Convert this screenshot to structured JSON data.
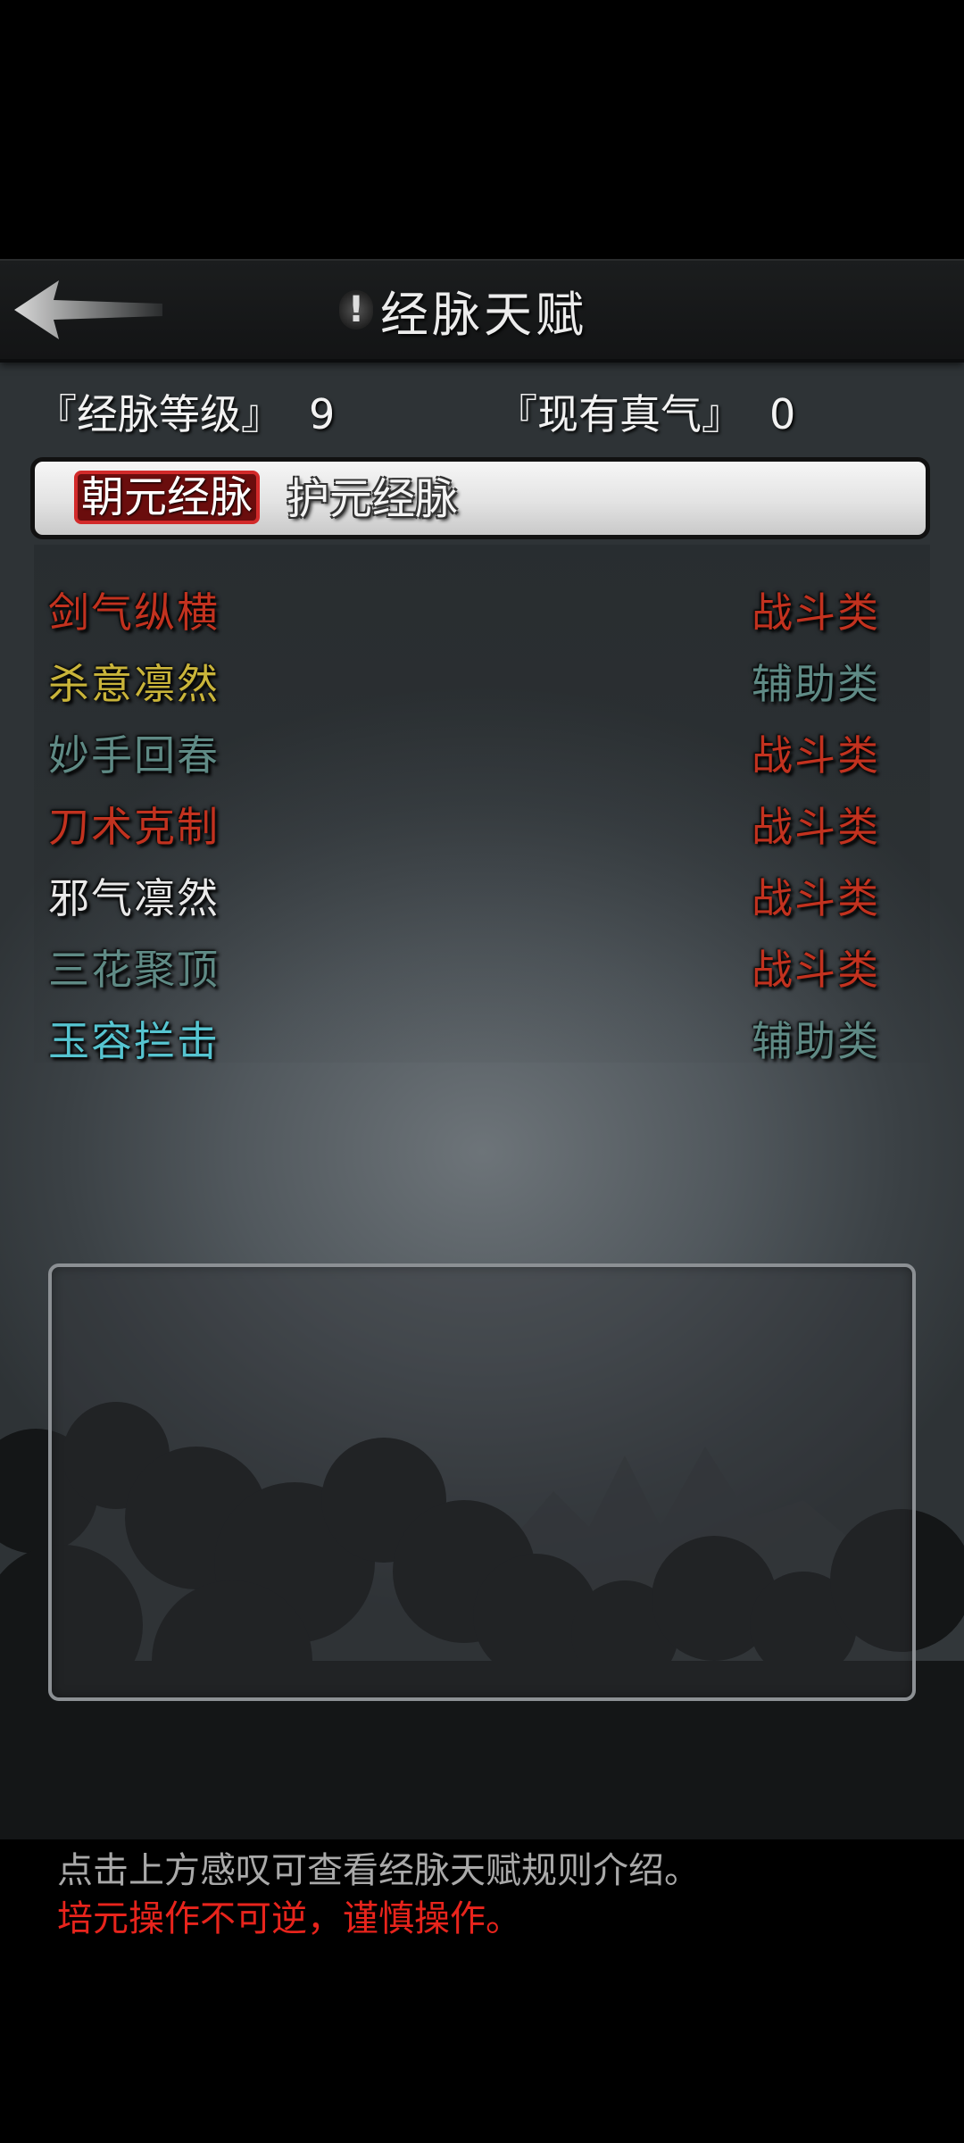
{
  "header": {
    "title": "经脉天赋",
    "info_glyph": "!",
    "back_icon": "back-arrow-icon"
  },
  "stats": {
    "level_label": "『经脉等级』",
    "level_value": "9",
    "qi_label": "『现有真气』",
    "qi_value": "0"
  },
  "tabs": [
    {
      "label": "朝元经脉",
      "active": true
    },
    {
      "label": "护元经脉",
      "active": false
    }
  ],
  "talents": [
    {
      "name": "剑气纵横",
      "name_color": "#c2321f",
      "category": "战斗类",
      "category_color": "#c2321f"
    },
    {
      "name": "杀意凛然",
      "name_color": "#c9b43a",
      "category": "辅助类",
      "category_color": "#5f8a85"
    },
    {
      "name": "妙手回春",
      "name_color": "#5f8a85",
      "category": "战斗类",
      "category_color": "#c2321f"
    },
    {
      "name": "刀术克制",
      "name_color": "#c2321f",
      "category": "战斗类",
      "category_color": "#c2321f"
    },
    {
      "name": "邪气凛然",
      "name_color": "#e8e8e8",
      "category": "战斗类",
      "category_color": "#c2321f"
    },
    {
      "name": "三花聚顶",
      "name_color": "#5f8a85",
      "category": "战斗类",
      "category_color": "#c2321f"
    },
    {
      "name": "玉容拦击",
      "name_color": "#56c4d0",
      "category": "辅助类",
      "category_color": "#5f8a85"
    }
  ],
  "notes": {
    "hint": "点击上方感叹可查看经脉天赋规则介绍。",
    "hint_color": "#a9a9a9",
    "warning": "培元操作不可逆，谨慎操作。",
    "warning_color": "#e8241c"
  },
  "colors": {
    "tab_active_fill": "#6a0d0d",
    "tab_active_border": "#d22a2a"
  }
}
